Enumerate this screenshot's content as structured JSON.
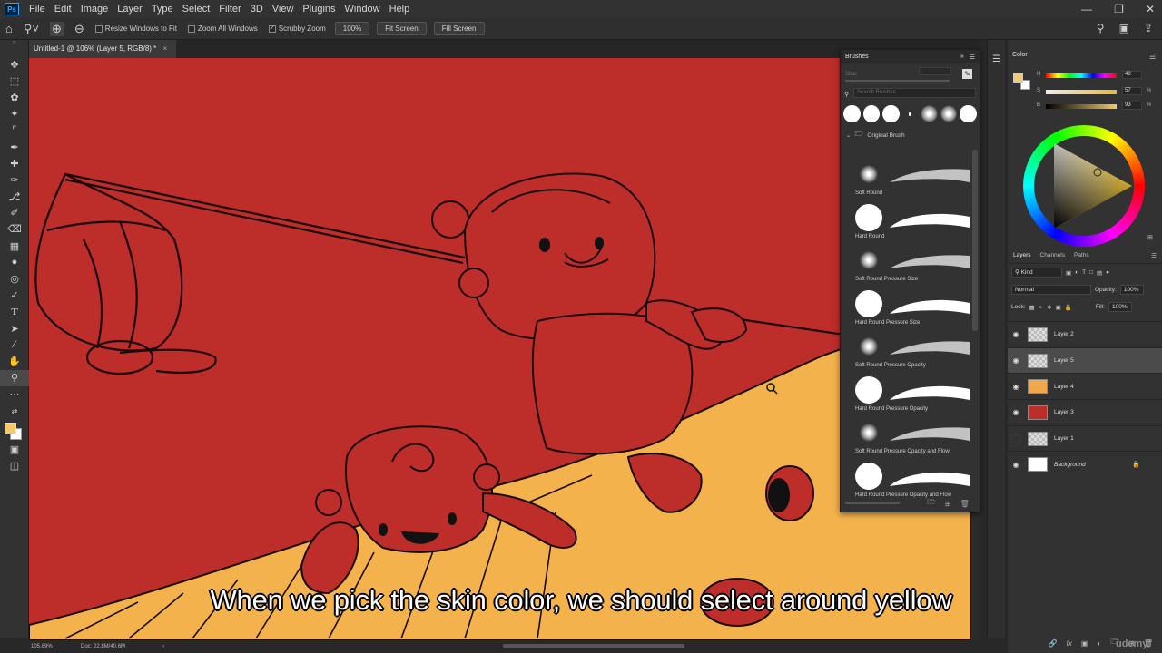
{
  "app": {
    "logo_text": "Ps",
    "menu": [
      "File",
      "Edit",
      "Image",
      "Layer",
      "Type",
      "Select",
      "Filter",
      "3D",
      "View",
      "Plugins",
      "Window",
      "Help"
    ]
  },
  "options_bar": {
    "resize_windows": "Resize Windows to Fit",
    "zoom_all_windows": "Zoom All Windows",
    "scrubby_zoom": "Scrubby Zoom",
    "zoom_value": "100%",
    "fit_screen": "Fit Screen",
    "fill_screen": "Fill Screen"
  },
  "document": {
    "tab_title": "Untitled-1 @ 106% (Layer 5, RGB/8) *",
    "status_zoom": "105.89%",
    "status_doc": "Doc: 22.8M/40.6M"
  },
  "subtitle": "When we pick the skin color, we should select around yellow",
  "brushes_panel": {
    "title": "Brushes",
    "size_label": "Size:",
    "search_placeholder": "Search Brushes",
    "folder_name": "Original Brush",
    "brushes": [
      {
        "name": "Soft Round",
        "tip": "soft"
      },
      {
        "name": "Hard Round",
        "tip": "hard"
      },
      {
        "name": "Soft Round Pressure Size",
        "tip": "soft"
      },
      {
        "name": "Hard Round Pressure Size",
        "tip": "hard"
      },
      {
        "name": "Soft Round Pressure Opacity",
        "tip": "soft"
      },
      {
        "name": "Hard Round Pressure Opacity",
        "tip": "hard"
      },
      {
        "name": "Soft Round Pressure Opacity and Flow",
        "tip": "soft"
      },
      {
        "name": "Hard Round Pressure Opacity and Flow",
        "tip": "hard"
      }
    ]
  },
  "color_panel": {
    "title": "Color",
    "h_label": "H",
    "s_label": "S",
    "b_label": "B",
    "h_value": "48",
    "s_value": "57",
    "b_value": "93",
    "pct": "%",
    "foreground": "#f5c86a",
    "background": "#ffffff"
  },
  "layers_panel": {
    "tabs": [
      "Layers",
      "Channels",
      "Paths"
    ],
    "kind_label": "Kind",
    "blend_mode": "Normal",
    "opacity_label": "Opacity:",
    "opacity_value": "100%",
    "lock_label": "Lock:",
    "fill_label": "Fill:",
    "fill_value": "100%",
    "layers": [
      {
        "name": "Layer 2",
        "visible": true,
        "thumb": "transparent",
        "selected": false
      },
      {
        "name": "Layer 5",
        "visible": true,
        "thumb": "transparent",
        "selected": true
      },
      {
        "name": "Layer 4",
        "visible": true,
        "thumb": "#f0a84a",
        "selected": false
      },
      {
        "name": "Layer 3",
        "visible": true,
        "thumb": "#bd2d29",
        "selected": false
      },
      {
        "name": "Layer 1",
        "visible": false,
        "thumb": "transparent",
        "selected": false
      },
      {
        "name": "Background",
        "visible": true,
        "thumb": "#ffffff",
        "selected": false,
        "locked": true
      }
    ]
  },
  "watermark": "udemy",
  "colors": {
    "canvas_red": "#bd2d29",
    "ground_yellow": "#f5b34e",
    "accent": "#31a8ff"
  }
}
